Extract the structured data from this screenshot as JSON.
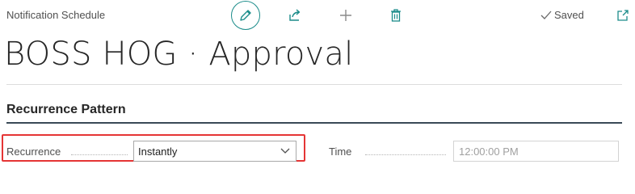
{
  "header": {
    "caption": "Notification Schedule",
    "saved_label": "Saved",
    "icons": [
      "edit-pencil-icon",
      "share-icon",
      "add-icon",
      "delete-icon",
      "open-new-window-icon"
    ]
  },
  "page": {
    "title": "BOSS HOG · Approval"
  },
  "section": {
    "title": "Recurrence Pattern"
  },
  "fields": {
    "recurrence": {
      "label": "Recurrence",
      "value": "Instantly"
    },
    "time": {
      "label": "Time",
      "value": "12:00:00 PM"
    }
  },
  "colors": {
    "accent": "#1b8c8a",
    "highlight": "#e53535"
  }
}
